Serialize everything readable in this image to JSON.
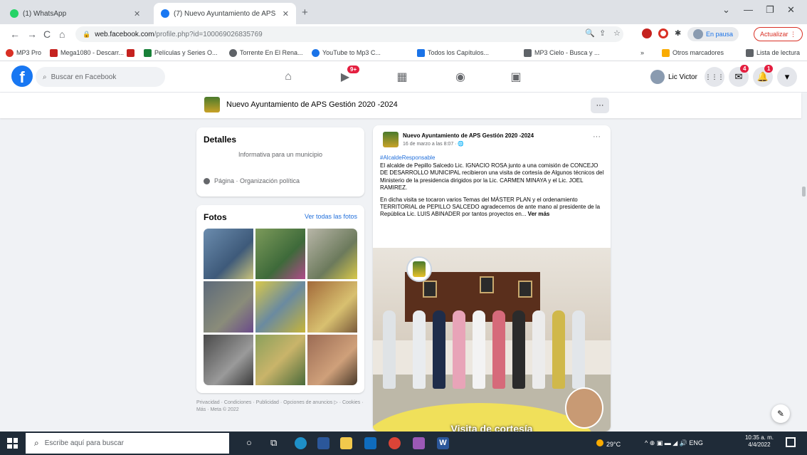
{
  "browser": {
    "tabs": [
      {
        "title": "(1) WhatsApp",
        "favicon_color": "#25d366",
        "active": false
      },
      {
        "title": "(7) Nuevo Ayuntamiento de APS",
        "favicon_color": "#1877f2",
        "active": true
      }
    ],
    "new_tab": "+",
    "window_controls": [
      "⌄",
      "—",
      "❐",
      "✕"
    ],
    "nav": {
      "back": "←",
      "forward": "→",
      "reload": "C",
      "home": "⌂"
    },
    "url_host": "web.facebook.com",
    "url_path": "/profile.php?id=100069026835769",
    "omnibox_icons": [
      "🔍",
      "⇪",
      "☆"
    ],
    "profile_pill": "En pausa",
    "update_pill": "Actualizar ⋮",
    "bookmarks": [
      {
        "label": "MP3 Pro",
        "color": "#d93025"
      },
      {
        "label": "Mega1080 - Descarr...",
        "color": "#c5221f"
      },
      {
        "label": "",
        "color": "#c5221f"
      },
      {
        "label": "Películas y Series O...",
        "color": "#188038"
      },
      {
        "label": "Torrente En El Rena...",
        "color": "#5f6368"
      },
      {
        "label": "YouTube to Mp3 C...",
        "color": "#1a73e8"
      },
      {
        "label": "Todos los Capítulos...",
        "color": "#1a73e8"
      },
      {
        "label": "MP3 Cielo - Busca y ...",
        "color": "#5f6368"
      }
    ],
    "bookmarks_right": [
      {
        "label": "Otros marcadores",
        "color": "#f9ab00"
      },
      {
        "label": "Lista de lectura",
        "color": "#5f6368"
      }
    ],
    "bookmarks_overflow": "»"
  },
  "facebook": {
    "logo": "f",
    "search_placeholder": "Buscar en Facebook",
    "nav_icons": [
      {
        "name": "home-icon",
        "glyph": "⌂"
      },
      {
        "name": "watch-icon",
        "glyph": "▶"
      },
      {
        "name": "marketplace-icon",
        "glyph": "▦"
      },
      {
        "name": "groups-icon",
        "glyph": "◉"
      },
      {
        "name": "gaming-icon",
        "glyph": "▣"
      }
    ],
    "watch_badge": "9+",
    "profile_name": "Lic Victor",
    "right_icons": {
      "menu": "⋮⋮⋮",
      "messenger": "✉",
      "notifications": "🔔",
      "account": "▾"
    },
    "messenger_badge": "4",
    "notifications_badge": "1"
  },
  "page": {
    "name": "Nuevo Ayuntamiento de APS Gestión 2020 -2024",
    "more": "···"
  },
  "details": {
    "title": "Detalles",
    "description": "Informativa para un municipio",
    "category": "Página · Organización política"
  },
  "photos": {
    "title": "Fotos",
    "see_all": "Ver todas las fotos",
    "colors": [
      "#6b8cae",
      "#7c9a5a",
      "#b8b6a8",
      "#5d6a7a",
      "#d8c84a",
      "#a26a3a",
      "#4a4a4a",
      "#8aa05c",
      "#9b6b54"
    ]
  },
  "footer": "Privacidad · Condiciones · Publicidad · Opciones de anuncios ▷ · Cookies · Más · Meta © 2022",
  "post": {
    "author": "Nuevo Ayuntamiento de APS Gestión 2020 -2024",
    "time": "16 de marzo a las 8:07 · 🌐",
    "more": "···",
    "hashtag": "#AlcaldeResponsable",
    "paragraph1": "El alcalde de Pepillo Salcedo Lic. IGNACIO ROSA junto a una comisión de CONCEJO DE DESARROLLO MUNICIPAL recibieron una visita de cortesía de Algunos técnicos del Ministerio de la presidencia dirigidos por la Lic. CARMEN MINAYA y el Lic. JOEL RAMIREZ.",
    "paragraph2": "En dicha visita se tocaron varios Temas del MÁSTER PLAN y el ordenamiento TERRITORIAL de PEPILLO SALCEDO agradecemos de ante mano al presidente de la República Lic. LUIS ABINADER por tantos proyectos en...",
    "see_more": "Ver más",
    "photo_caption": "Visita de cortesía"
  },
  "fab": "✎",
  "taskbar": {
    "search_placeholder": "Escribe aquí para buscar",
    "search_icon": "⌕",
    "apps": [
      {
        "name": "cortana-icon",
        "glyph": "○",
        "color": ""
      },
      {
        "name": "task-view-icon",
        "glyph": "⧉",
        "color": ""
      },
      {
        "name": "edge-icon",
        "glyph": "",
        "color": "#1e90c8"
      },
      {
        "name": "store-icon",
        "glyph": "",
        "color": "#2b579a"
      },
      {
        "name": "explorer-icon",
        "glyph": "",
        "color": "#f2c94c"
      },
      {
        "name": "mail-icon",
        "glyph": "",
        "color": "#0f6cbd"
      },
      {
        "name": "chrome-icon",
        "glyph": "",
        "color": "#db4437"
      },
      {
        "name": "paint-icon",
        "glyph": "",
        "color": "#9b59b6"
      },
      {
        "name": "word-icon",
        "glyph": "W",
        "color": "#2b579a"
      }
    ],
    "weather": "29°C",
    "tray": "^ ⊕ ▣ ▬ ◢ 🔊 ENG",
    "time": "10:35 a. m.",
    "date": "4/4/2022"
  }
}
